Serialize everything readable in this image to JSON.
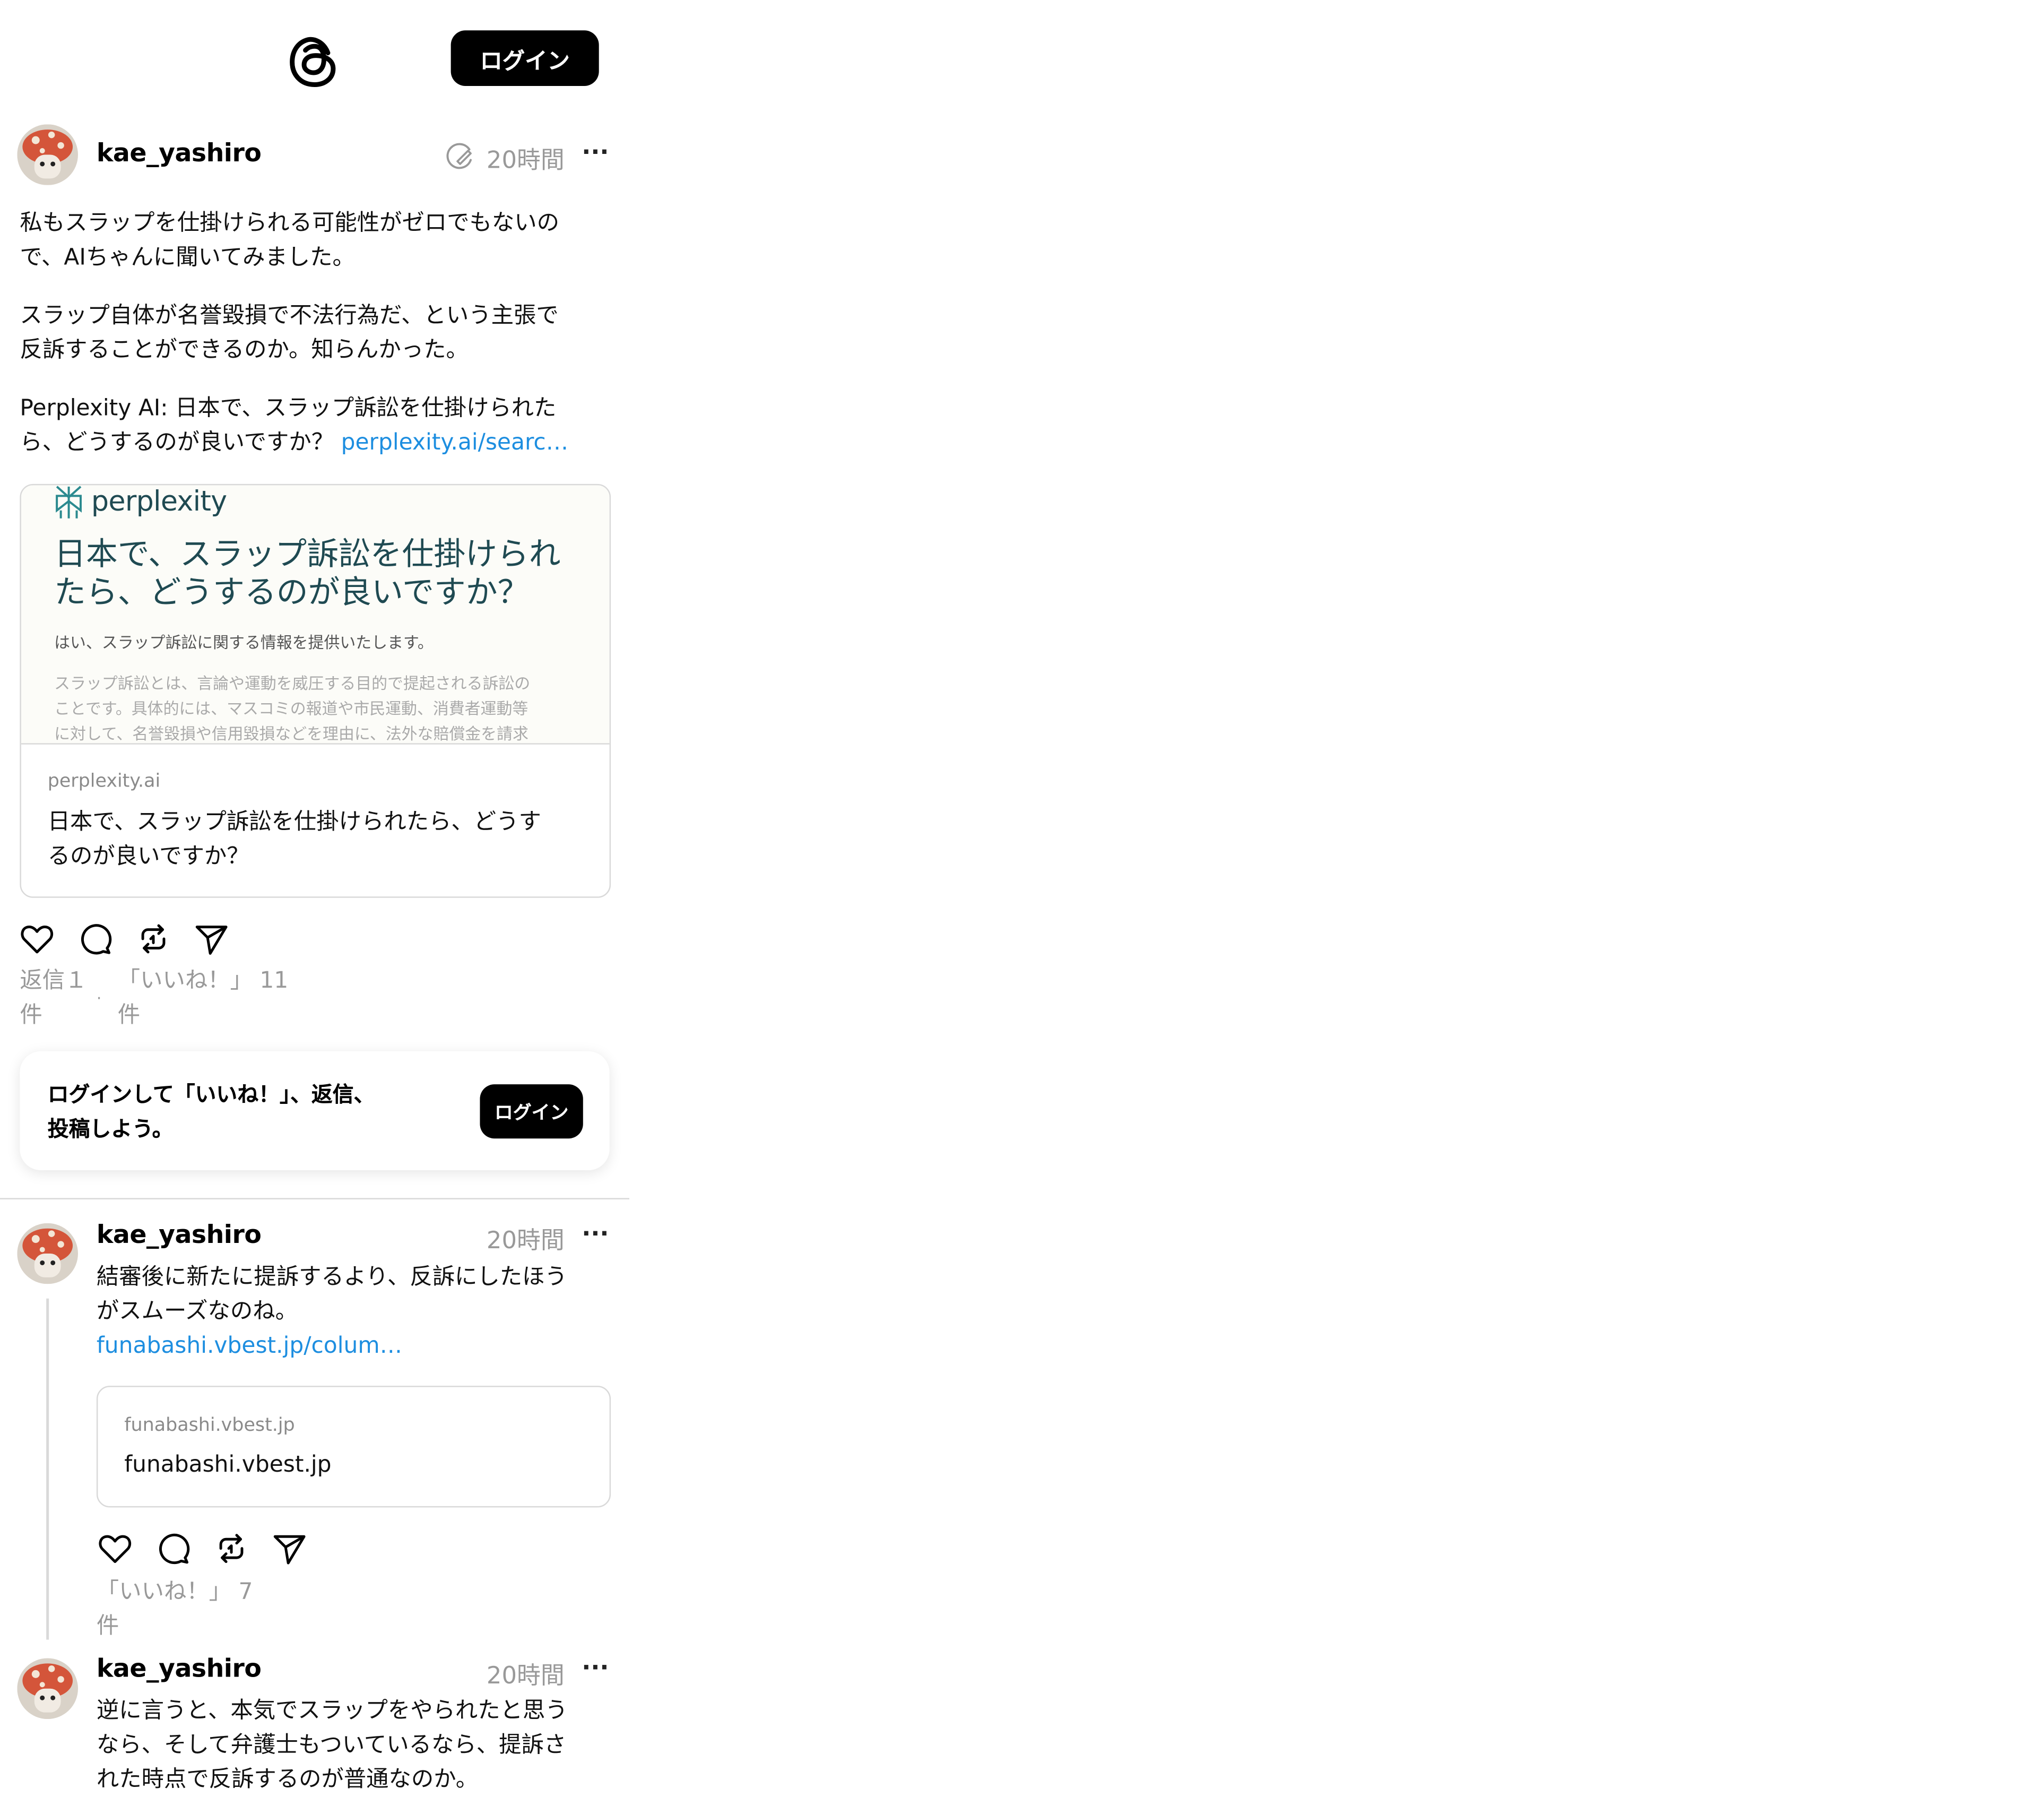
{
  "header": {
    "logo_icon": "threads-logo-icon",
    "login_label": "ログイン"
  },
  "post": {
    "username": "kae_yashiro",
    "edited_icon": "edit-pencil-icon",
    "time": "20時間",
    "more": "···",
    "paragraphs": [
      [
        "私もスラップを仕掛けられる可能性がゼロでもないの",
        "で、AIちゃんに聞いてみました。"
      ],
      [
        "スラップ自体が名誉毀損で不法行為だ、という主張で",
        "反訴することができるのか。知らんかった。"
      ]
    ],
    "p3_line1": "Perplexity AI: 日本で、スラップ訴訟を仕掛けられた",
    "p3_line2": "ら、どうするのが良いですか？",
    "p3_link": "perplexity.ai/searc…",
    "card": {
      "brand": "perplexity",
      "preview_title": [
        "日本で、スラップ訴訟を仕掛けられ",
        "たら、どうするのが良いですか？"
      ],
      "preview_answer": "はい、スラップ訴訟に関する情報を提供いたします。",
      "preview_detail": [
        "スラップ訴訟とは、言論や運動を威圧する目的で提起される訴訟の",
        "ことです。具体的には、マスコミの報道や市民運動、消費者運動等",
        "に対して、名誉毀損や信用毀損などを理由に、法外な賠償金を請求"
      ],
      "domain": "perplexity.ai",
      "title": [
        "日本で、スラップ訴訟を仕掛けられたら、どうす",
        "るのが良いですか？"
      ]
    },
    "actions": [
      "like-icon",
      "reply-icon",
      "repost-icon",
      "share-icon"
    ],
    "replies": [
      "返信１",
      "件"
    ],
    "separator": "·",
    "likes": [
      "「いいね！」 11",
      "件"
    ]
  },
  "login_prompt": {
    "text": [
      "ログインして「いいね！」、返信、",
      "投稿しよう。"
    ],
    "button": "ログイン"
  },
  "reply1": {
    "username": "kae_yashiro",
    "time": "20時間",
    "more": "···",
    "text": [
      "結審後に新たに提訴するより、反訴にしたほう",
      "がスムーズなのね。"
    ],
    "link": "funabashi.vbest.jp/colum…",
    "card": {
      "domain": "funabashi.vbest.jp",
      "title": "funabashi.vbest.jp"
    },
    "likes": [
      "「いいね！」 7",
      "件"
    ]
  },
  "reply2": {
    "username": "kae_yashiro",
    "time": "20時間",
    "more": "···",
    "text": [
      "逆に言うと、本気でスラップをやられたと思う",
      "なら、そして弁護士もついているなら、提訴さ",
      "れた時点で反訴するのが普通なのか。"
    ]
  }
}
